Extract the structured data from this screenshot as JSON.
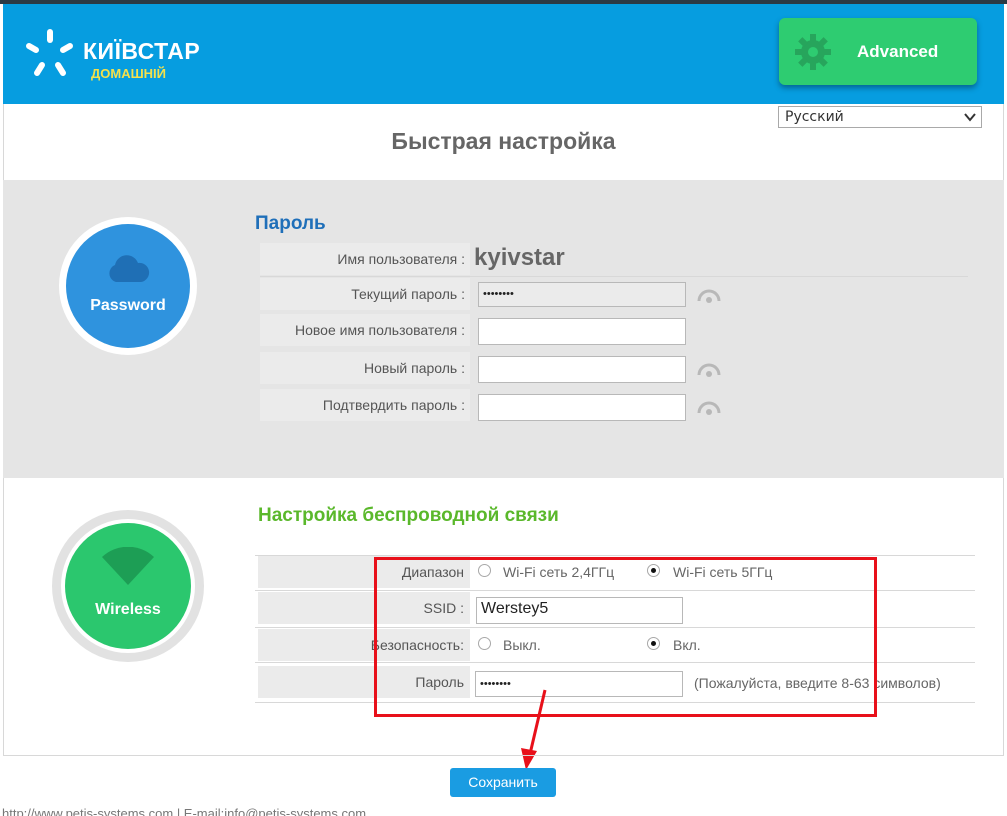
{
  "brand": {
    "line1": "КИЇВСТАР",
    "line2": "ДОМАШНІЙ",
    "sun_color": "#ffffff"
  },
  "header": {
    "advanced_label": "Advanced",
    "language": "Русский",
    "bg_color": "#069de0",
    "advanced_color": "#2ecc71"
  },
  "page_title": "Быстрая настройка",
  "password_section": {
    "badge_label": "Password",
    "title": "Пароль",
    "username_label": "Имя пользователя :",
    "username_value": "kyivstar",
    "current_password_label": "Текущий пароль :",
    "current_password_value": "••••••••",
    "new_username_label": "Новое имя пользователя :",
    "new_username_value": "",
    "new_password_label": "Новый пароль :",
    "new_password_value": "",
    "confirm_password_label": "Подтвердить пароль :",
    "confirm_password_value": ""
  },
  "wireless_section": {
    "badge_label": "Wireless",
    "title": "Настройка беспроводной связи",
    "band_label": "Диапазон",
    "band_options": [
      "Wi-Fi сеть 2,4ГГц",
      "Wi-Fi сеть 5ГГц"
    ],
    "band_selected": "Wi-Fi сеть 5ГГц",
    "ssid_label": "SSID :",
    "ssid_value": "Wersteу5",
    "security_label": "Безопасность:",
    "security_options": [
      "Выкл.",
      "Вкл."
    ],
    "security_selected": "Вкл.",
    "password_label": "Пароль",
    "password_value": "••••••••",
    "password_hint": "(Пожалуйста, введите 8-63 символов)"
  },
  "save_label": "Сохранить",
  "footer": "http://www.petis-systems.com | E-mail:info@petis-systems.com",
  "annotation_color": "#e8101a"
}
